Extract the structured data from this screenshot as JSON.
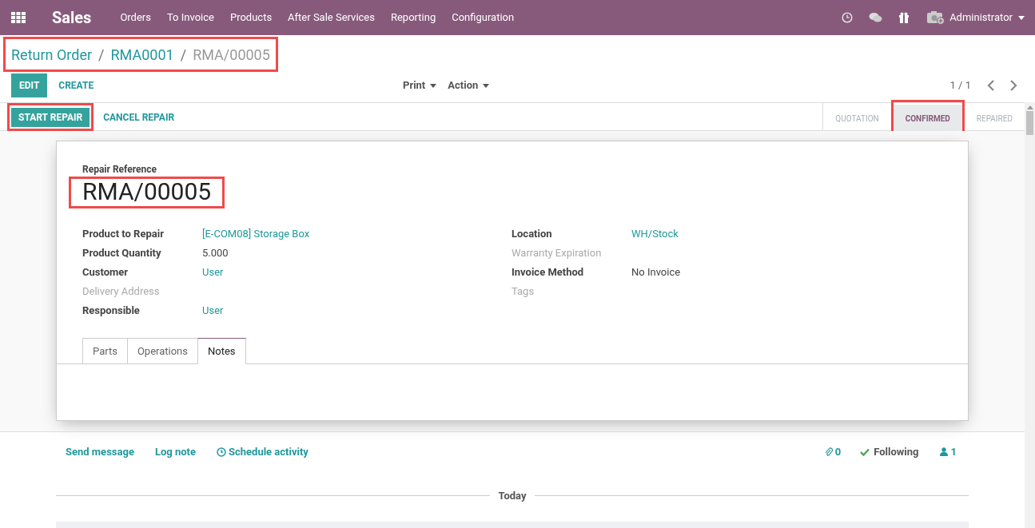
{
  "navbar": {
    "app_name": "Sales",
    "menu": [
      "Orders",
      "To Invoice",
      "Products",
      "After Sale Services",
      "Reporting",
      "Configuration"
    ],
    "user": "Administrator"
  },
  "breadcrumb": {
    "highlighted": true,
    "separator": "/",
    "items": [
      {
        "label": "Return Order",
        "current": false
      },
      {
        "label": "RMA0001",
        "current": false
      },
      {
        "label": "RMA/00005",
        "current": true
      }
    ]
  },
  "toolbar": {
    "buttons": [
      {
        "label": "EDIT",
        "primary": true
      },
      {
        "label": "CREATE",
        "primary": false
      }
    ],
    "dropdowns": [
      "Print",
      "Action"
    ],
    "pager": "1 / 1"
  },
  "statusbar": {
    "buttons": [
      {
        "label": "START REPAIR",
        "primary": true,
        "highlighted": true
      },
      {
        "label": "CANCEL REPAIR",
        "primary": false,
        "highlighted": false
      }
    ],
    "stages": [
      {
        "label": "QUOTATION",
        "selected": false,
        "highlighted": false
      },
      {
        "label": "CONFIRMED",
        "selected": true,
        "highlighted": true
      },
      {
        "label": "REPAIRED",
        "selected": false,
        "highlighted": false
      }
    ]
  },
  "form": {
    "reference_label": "Repair Reference",
    "reference": "RMA/00005",
    "reference_highlighted": true,
    "left_fields": [
      {
        "label": "Product to Repair",
        "value": "[E-COM08] Storage Box",
        "link": true,
        "muted": false
      },
      {
        "label": "Product Quantity",
        "value": "5.000",
        "link": false,
        "muted": false
      },
      {
        "label": "Customer",
        "value": "User",
        "link": true,
        "muted": false
      },
      {
        "label": "Delivery Address",
        "muted": true
      },
      {
        "label": "Responsible",
        "value": "User",
        "link": true,
        "muted": false
      }
    ],
    "right_fields": [
      {
        "label": "Location",
        "value": "WH/Stock",
        "link": true,
        "muted": false
      },
      {
        "label": "Warranty Expiration",
        "muted": true
      },
      {
        "label": "Invoice Method",
        "value": "No Invoice",
        "link": false,
        "muted": false
      },
      {
        "label": "Tags",
        "muted": true
      }
    ],
    "tabs": [
      {
        "label": "Parts",
        "selected": false
      },
      {
        "label": "Operations",
        "selected": false
      },
      {
        "label": "Notes",
        "selected": true
      }
    ]
  },
  "chatter": {
    "actions": [
      "Send message",
      "Log note",
      "Schedule activity"
    ],
    "attachments": "0",
    "following": "Following",
    "followers": "1",
    "date_separator": "Today"
  }
}
